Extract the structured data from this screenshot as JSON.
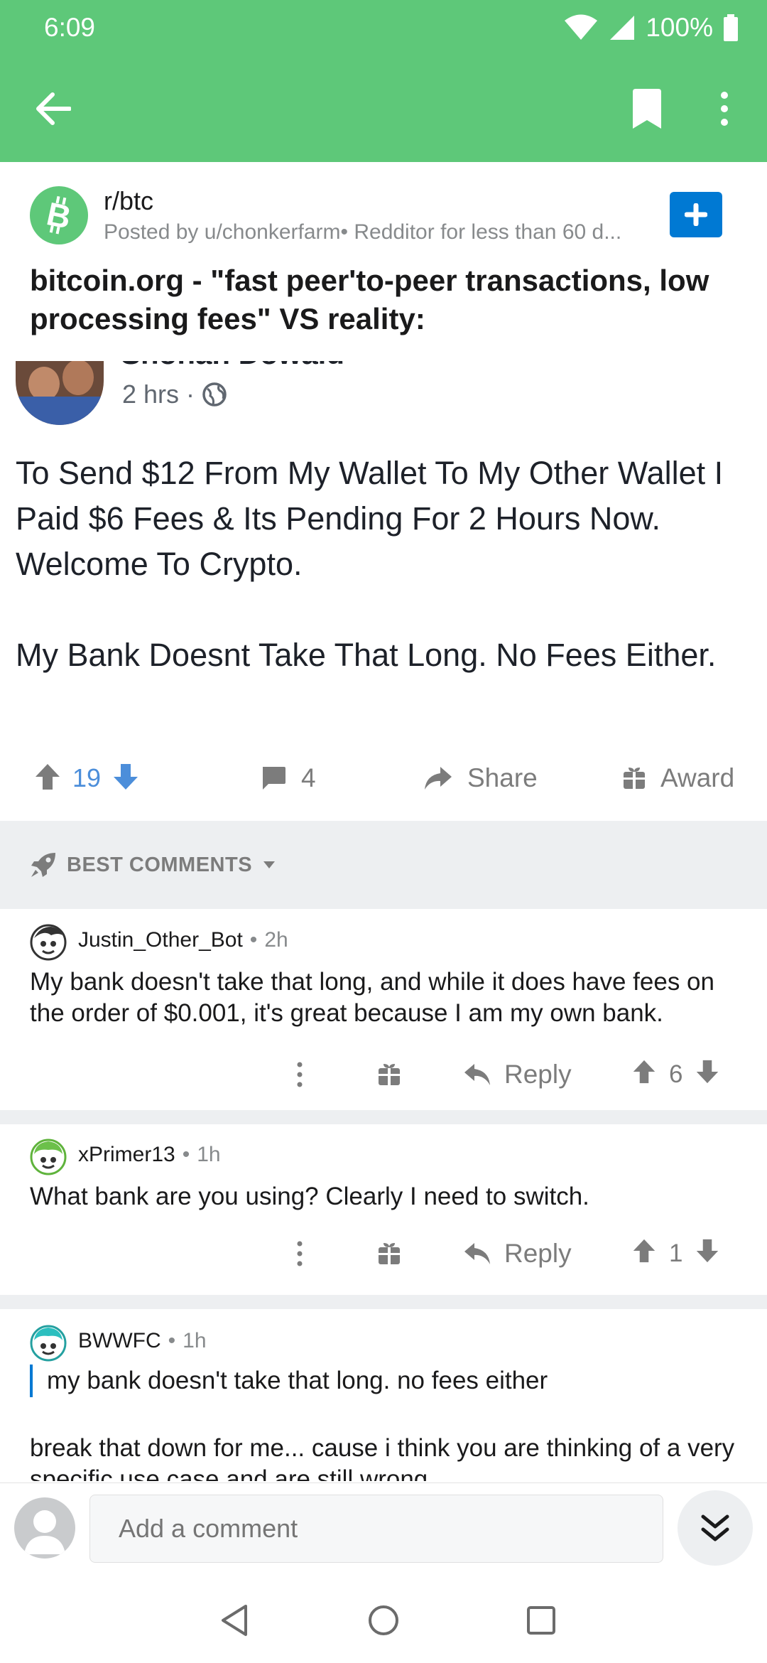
{
  "status": {
    "time": "6:09",
    "battery": "100%"
  },
  "post": {
    "subreddit": "r/btc",
    "meta": "Posted by u/chonkerfarm• Redditor for less than 60 d...",
    "title": "bitcoin.org - \"fast peer'to-peer transactions, low processing fees\" VS reality:",
    "image": {
      "author_partial": "Shohan Dowald",
      "time": "2 hrs",
      "text": "To Send $12 From My Wallet To My Other Wallet I Paid $6 Fees & Its Pending For 2 Hours Now. Welcome To Crypto.\n\nMy Bank Doesnt Take That Long. No Fees Either."
    },
    "votes": "19",
    "comments": "4",
    "share_label": "Share",
    "award_label": "Award"
  },
  "sort": {
    "label": "BEST COMMENTS"
  },
  "comments": [
    {
      "author": "Justin_Other_Bot",
      "age": "2h",
      "body": "My bank doesn't take that long, and while it does have fees on the order of $0.001, it's great because I am my own bank.",
      "reply_label": "Reply",
      "votes": "6"
    },
    {
      "author": "xPrimer13",
      "age": "1h",
      "body": "What bank are you using? Clearly I need to switch.",
      "reply_label": "Reply",
      "votes": "1"
    },
    {
      "author": "BWWFC",
      "age": "1h",
      "quote": "my bank doesn't take that long. no fees either",
      "body": "break that down for me... cause i think you are thinking of a very specific use case and are still wrong."
    }
  ],
  "input": {
    "placeholder": "Add a comment"
  },
  "colors": {
    "app_bar": "#5ec879",
    "upvote_active": "#4c8eda",
    "join_button": "#0079d3"
  }
}
